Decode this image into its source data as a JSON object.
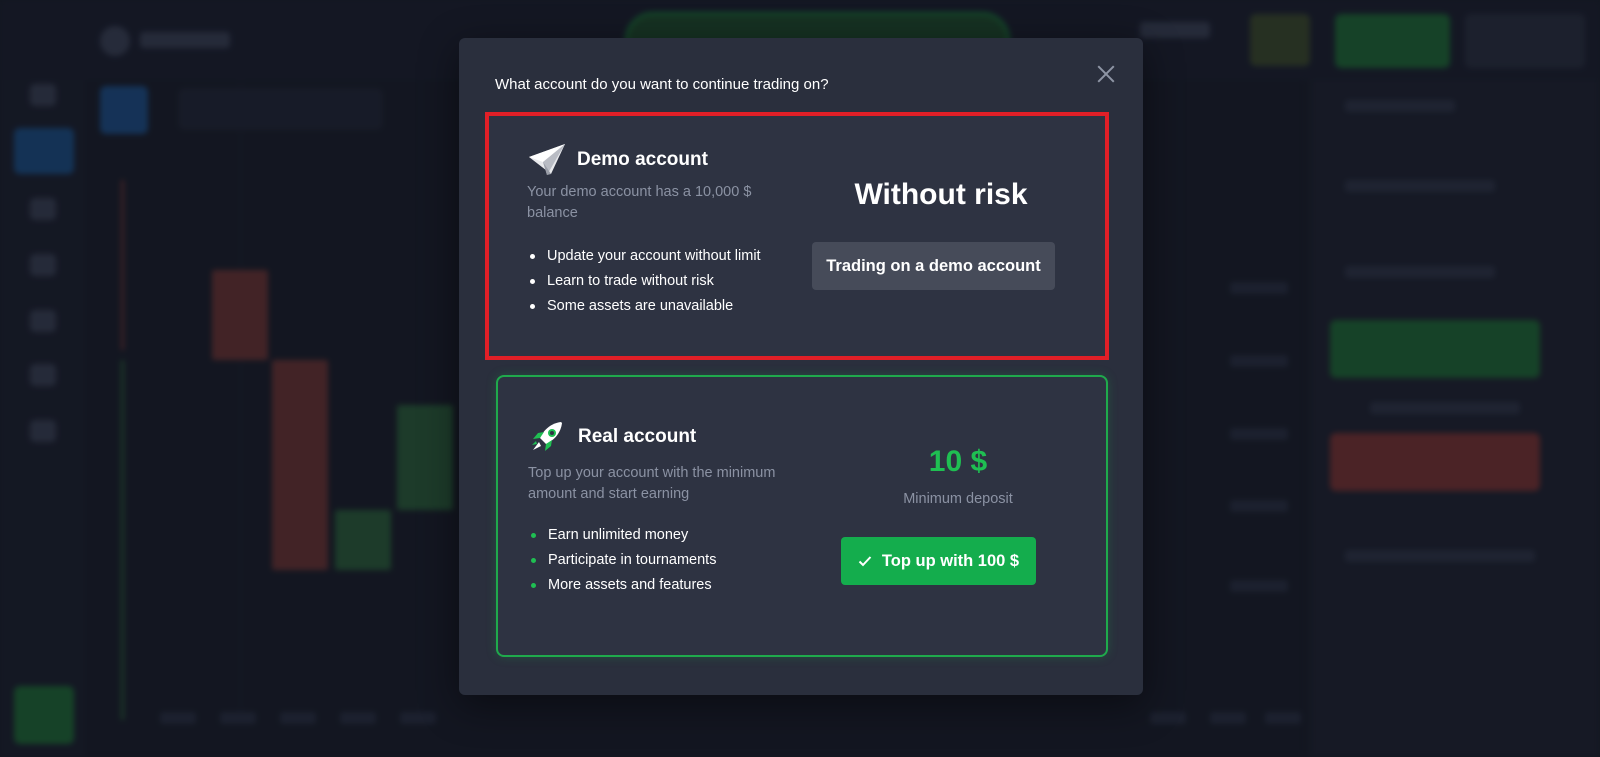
{
  "modal": {
    "title": "What account do you want to continue trading on?"
  },
  "demo": {
    "title": "Demo account",
    "description": "Your demo account has a 10,000 $ balance",
    "features": [
      "Update your account without limit",
      "Learn to trade without risk",
      "Some assets are unavailable"
    ],
    "headline": "Without risk",
    "button_label": "Trading on a demo account",
    "icon": "paper-plane-icon",
    "highlight_color": "#e11f27"
  },
  "real": {
    "title": "Real account",
    "description": "Top up your account with the minimum amount and start earning",
    "features": [
      "Earn unlimited money",
      "Participate in tournaments",
      "More assets and features"
    ],
    "min_value": "10 $",
    "min_label": "Minimum deposit",
    "button_label": "Top up with 100 $",
    "icon": "rocket-icon",
    "accent_color": "#1fbf52"
  }
}
